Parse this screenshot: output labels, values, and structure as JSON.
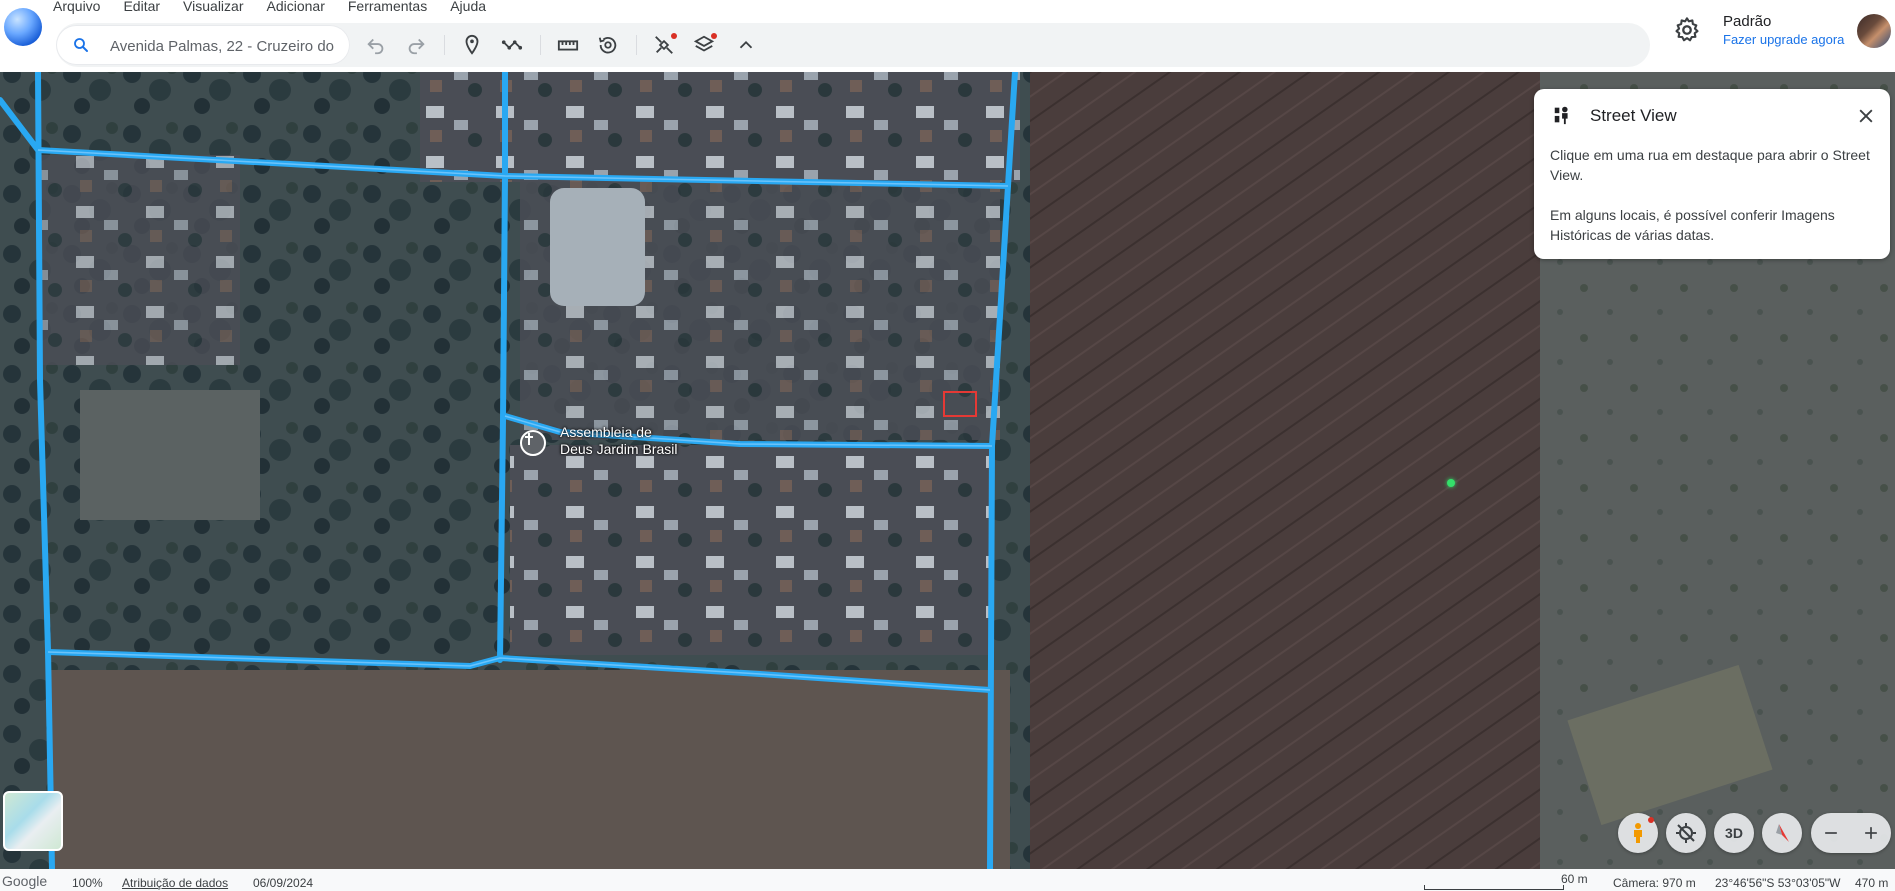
{
  "menu": {
    "items": [
      "Arquivo",
      "Editar",
      "Visualizar",
      "Adicionar",
      "Ferramentas",
      "Ajuda"
    ]
  },
  "search": {
    "value": "Avenida Palmas, 22 - Cruzeiro do"
  },
  "toolbar": {
    "buttons": [
      "undo-icon",
      "redo-icon",
      "placemark-icon",
      "path-icon",
      "ruler-icon",
      "history-icon",
      "satellite-icon",
      "layers-icon",
      "chevron-up-icon"
    ]
  },
  "account": {
    "profile_name": "Padrão",
    "upgrade_label": "Fazer upgrade agora"
  },
  "map": {
    "place_label_line1": "Assembleia de",
    "place_label_line2": "Deus Jardim Brasil",
    "road_color": "#29a8f2",
    "selection_color": "#e53935"
  },
  "street_view_panel": {
    "title": "Street View",
    "text1": "Clique em uma rua em destaque para abrir o Street View.",
    "text2": "Em alguns locais, é possível conferir Imagens Históricas de várias datas."
  },
  "controls": {
    "three_d_label": "3D"
  },
  "statusbar": {
    "brand": "Google",
    "zoom": "100%",
    "attribution": "Atribuição de dados",
    "date": "06/09/2024",
    "scale": "60 m",
    "camera": "Câmera: 970 m",
    "coords": "23°46'56\"S 53°03'05\"W",
    "elevation": "470 m"
  }
}
